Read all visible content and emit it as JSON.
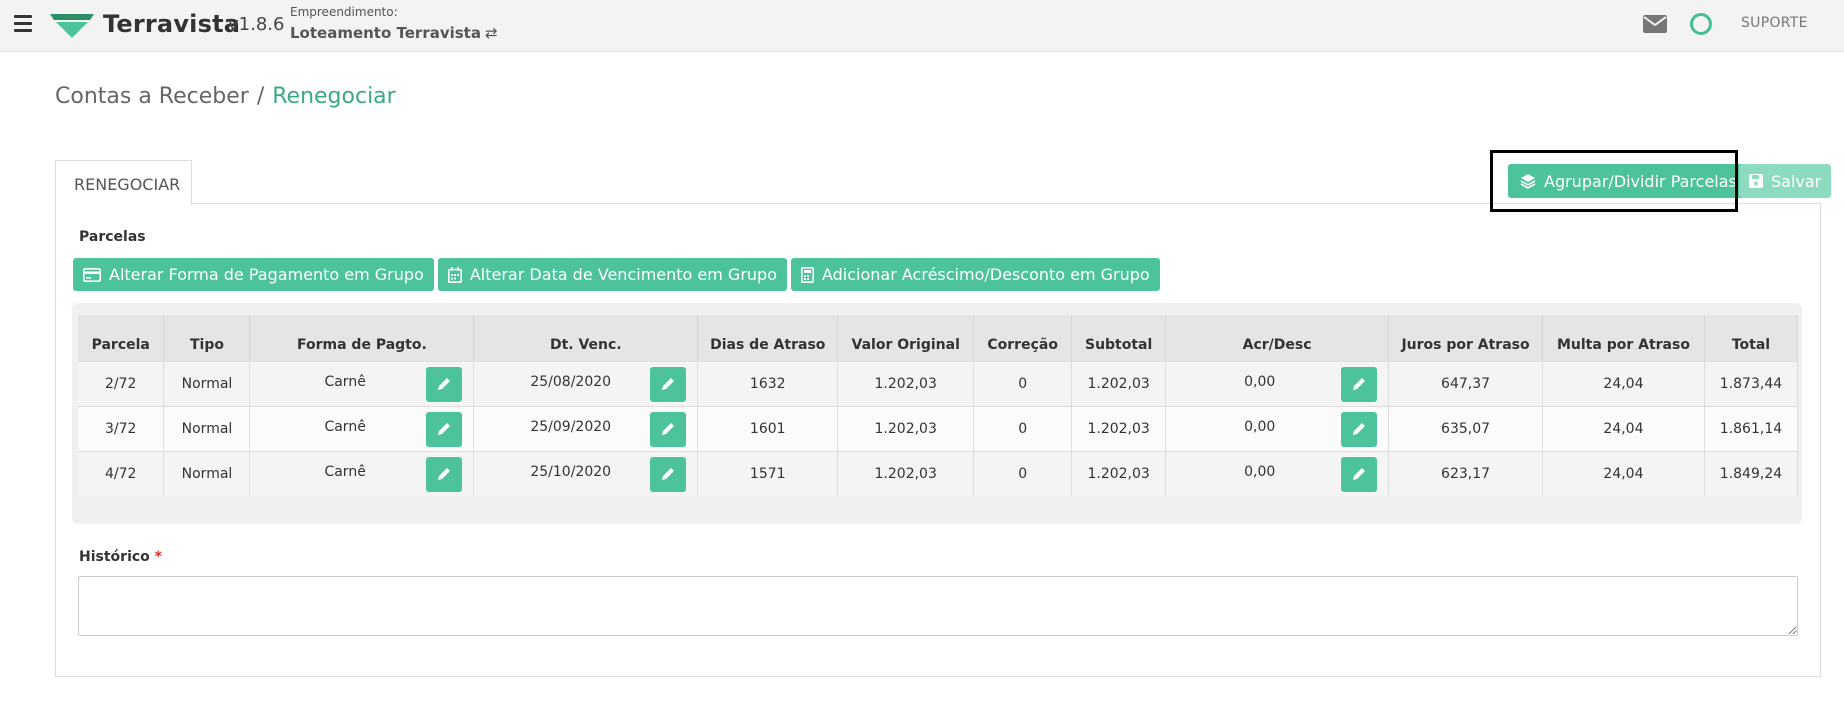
{
  "header": {
    "brand": "Terravista",
    "version": "v1.8.6",
    "empreendimento_label": "Empreendimento:",
    "empreendimento_value": "Loteamento Terravista",
    "swap_glyph": "⇄",
    "support_label": "SUPORTE",
    "accent_color": "#4cc39a"
  },
  "breadcrumb": {
    "parent": "Contas a Receber",
    "separator": "/",
    "current": "Renegociar"
  },
  "tab": {
    "label": "RENEGOCIAR"
  },
  "actions": {
    "agrupar_label": "Agrupar/Dividir Parcelas",
    "salvar_label": "Salvar"
  },
  "parcelas": {
    "section_label": "Parcelas",
    "group_buttons": [
      {
        "label": "Alterar Forma de Pagamento em Grupo",
        "icon": "credit-card-icon"
      },
      {
        "label": "Alterar Data de Vencimento em Grupo",
        "icon": "calendar-icon"
      },
      {
        "label": "Adicionar Acréscimo/Desconto em Grupo",
        "icon": "calculator-icon"
      }
    ],
    "columns": [
      "Parcela",
      "Tipo",
      "Forma de Pagto.",
      "Dt. Venc.",
      "Dias de Atraso",
      "Valor Original",
      "Correção",
      "Subtotal",
      "Acr/Desc",
      "Juros por Atraso",
      "Multa por Atraso",
      "Total"
    ],
    "rows": [
      {
        "parcela": "2/72",
        "tipo": "Normal",
        "forma": "Carnê",
        "dt_venc": "25/08/2020",
        "dias_atraso": "1632",
        "valor_original": "1.202,03",
        "correcao": "0",
        "subtotal": "1.202,03",
        "acr_desc": "0,00",
        "juros": "647,37",
        "multa": "24,04",
        "total": "1.873,44"
      },
      {
        "parcela": "3/72",
        "tipo": "Normal",
        "forma": "Carnê",
        "dt_venc": "25/09/2020",
        "dias_atraso": "1601",
        "valor_original": "1.202,03",
        "correcao": "0",
        "subtotal": "1.202,03",
        "acr_desc": "0,00",
        "juros": "635,07",
        "multa": "24,04",
        "total": "1.861,14"
      },
      {
        "parcela": "4/72",
        "tipo": "Normal",
        "forma": "Carnê",
        "dt_venc": "25/10/2020",
        "dias_atraso": "1571",
        "valor_original": "1.202,03",
        "correcao": "0",
        "subtotal": "1.202,03",
        "acr_desc": "0,00",
        "juros": "623,17",
        "multa": "24,04",
        "total": "1.849,24"
      }
    ]
  },
  "historico": {
    "label": "Histórico",
    "required_mark": "*",
    "value": ""
  }
}
